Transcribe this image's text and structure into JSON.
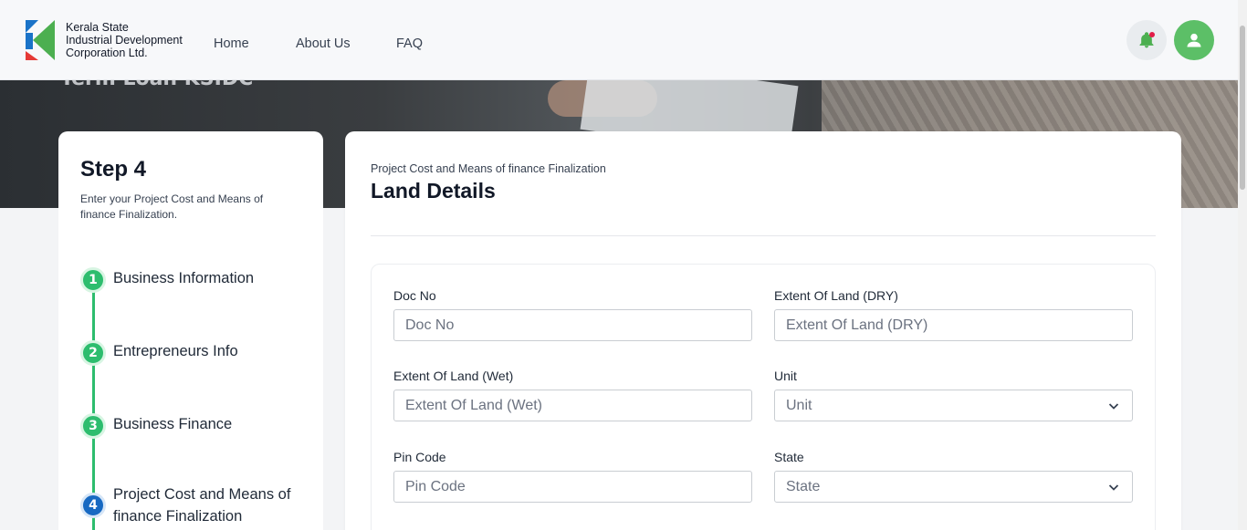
{
  "header": {
    "org_name_lines": [
      "Kerala State",
      "Industrial Development",
      "Corporation Ltd."
    ],
    "nav": [
      {
        "label": "Home"
      },
      {
        "label": "About Us"
      },
      {
        "label": "FAQ"
      }
    ],
    "bell_icon": "bell-icon",
    "user_icon": "user-icon",
    "brand_colors": {
      "green": "#5cbf67",
      "blue": "#1a73c8",
      "red": "#e53935"
    }
  },
  "hero": {
    "title": "Term Loan KSIDC"
  },
  "steps_panel": {
    "title": "Step 4",
    "description": "Enter your Project Cost and Means of finance Finalization.",
    "items": [
      {
        "number": "1",
        "label": "Business Information",
        "state": "done"
      },
      {
        "number": "2",
        "label": "Entrepreneurs Info",
        "state": "done"
      },
      {
        "number": "3",
        "label": "Business Finance",
        "state": "done"
      },
      {
        "number": "4",
        "label": "Project Cost and Means of finance Finalization",
        "state": "active"
      }
    ]
  },
  "main": {
    "subtitle": "Project Cost and Means of finance Finalization",
    "title": "Land Details",
    "fields": {
      "doc_no": {
        "label": "Doc No",
        "placeholder": "Doc No"
      },
      "extent_dry": {
        "label": "Extent Of Land (DRY)",
        "placeholder": "Extent Of Land (DRY)"
      },
      "extent_wet": {
        "label": "Extent Of Land (Wet)",
        "placeholder": "Extent Of Land (Wet)"
      },
      "unit": {
        "label": "Unit",
        "value": "Unit"
      },
      "pin_code": {
        "label": "Pin Code",
        "placeholder": "Pin Code"
      },
      "state": {
        "label": "State",
        "value": "State"
      }
    }
  }
}
